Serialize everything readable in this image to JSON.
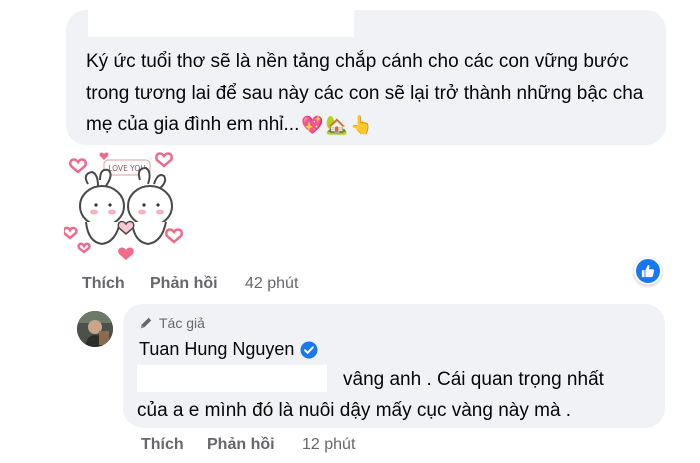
{
  "comment1": {
    "text": "Ký ức tuổi thơ sẽ là nền tảng chắp cánh cho các con vững bước trong tương lai để sau này các con sẽ lại trở thành những bậc cha mẹ của gia đình em nhỉ...",
    "emojis": [
      "💖",
      "🏡",
      "👆"
    ],
    "sticker_text": "LOVE YOU",
    "like_label": "Thích",
    "reply_label": "Phản hồi",
    "time": "42 phút"
  },
  "comment2": {
    "author_badge": "Tác giả",
    "author_name": "Tuan Hung Nguyen",
    "text_line1": "vâng anh . Cái quan trọng nhất",
    "text_line2": "của a e mình đó là nuôi dậy mấy cục vàng này mà .",
    "like_label": "Thích",
    "reply_label": "Phản hồi",
    "time": "12 phút"
  },
  "colors": {
    "bubble": "#f0f2f5",
    "meta_text": "#65676b",
    "like_blue": "#1877f2",
    "heart_pink": "#f06a8a"
  }
}
